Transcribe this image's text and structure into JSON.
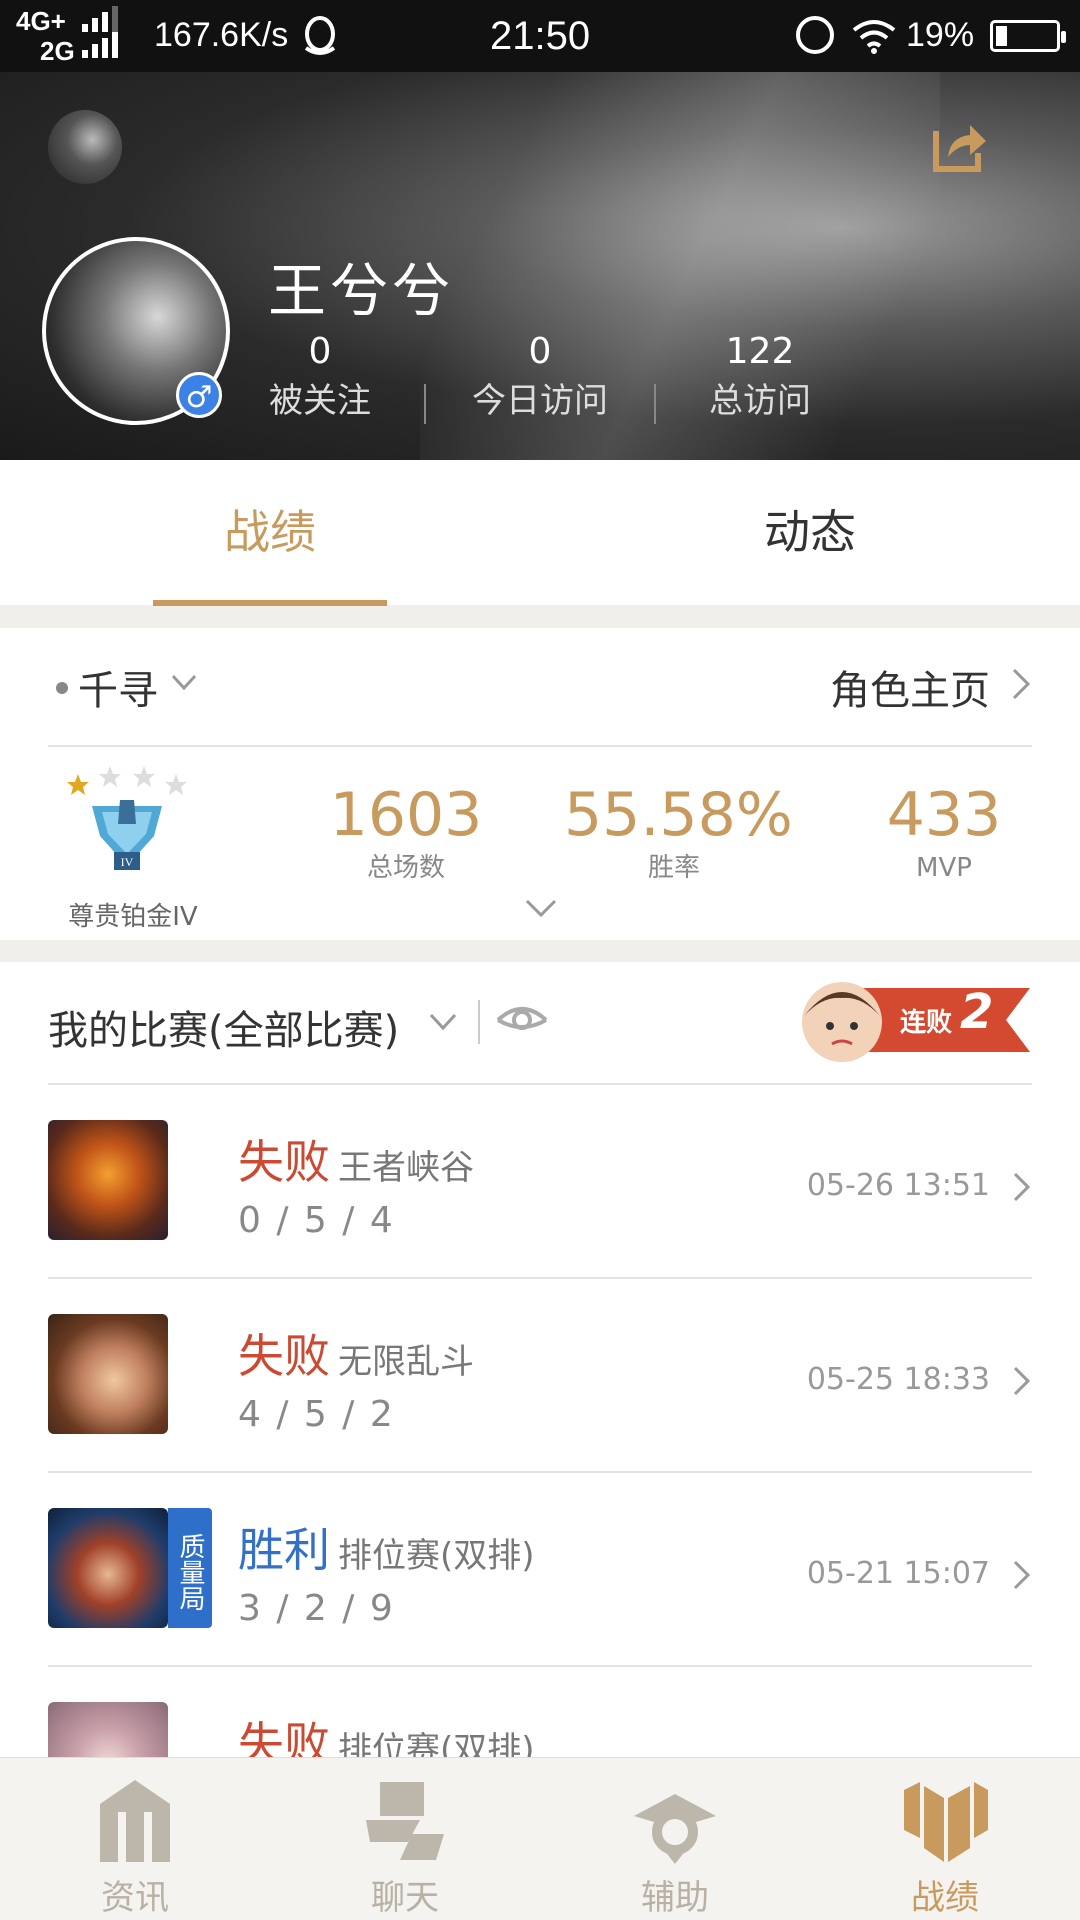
{
  "status_bar": {
    "network_top": "4G+",
    "network_bottom": "2G",
    "speed": "167.6K/s",
    "time": "21:50",
    "battery": "19%",
    "battery_level": 0.19
  },
  "profile": {
    "username": "王兮兮",
    "gender_symbol": "♂",
    "stats": [
      {
        "value": "0",
        "label": "被关注"
      },
      {
        "value": "0",
        "label": "今日访问"
      },
      {
        "value": "122",
        "label": "总访问"
      }
    ]
  },
  "tabs": [
    {
      "label": "战绩",
      "active": true
    },
    {
      "label": "动态",
      "active": false
    }
  ],
  "character": {
    "name": "千寻",
    "role_link": "角色主页",
    "rank_name": "尊贵铂金IV",
    "rank_stars": 4,
    "stats": [
      {
        "value": "1603",
        "label": "总场数"
      },
      {
        "value": "55.58%",
        "label": "胜率"
      },
      {
        "value": "433",
        "label": "MVP"
      }
    ]
  },
  "matches": {
    "title": "我的比赛(全部比赛)",
    "streak_label": "连败",
    "streak_count": "2",
    "items": [
      {
        "result": "失败",
        "outcome": "lose",
        "mode": "王者峡谷",
        "kda": "0 / 5 / 4",
        "date": "05-26 13:51",
        "quality_tag": ""
      },
      {
        "result": "失败",
        "outcome": "lose",
        "mode": "无限乱斗",
        "kda": "4 / 5 / 2",
        "date": "05-25 18:33",
        "quality_tag": ""
      },
      {
        "result": "胜利",
        "outcome": "win",
        "mode": "排位赛(双排)",
        "kda": "3 / 2 / 9",
        "date": "05-21 15:07",
        "quality_tag": "质量局"
      },
      {
        "result": "失败",
        "outcome": "lose",
        "mode": "排位赛(双排)",
        "kda": "",
        "date": "",
        "quality_tag": ""
      }
    ]
  },
  "bottom_nav": [
    {
      "label": "资讯",
      "icon": "news-icon",
      "active": false
    },
    {
      "label": "聊天",
      "icon": "chat-icon",
      "active": false
    },
    {
      "label": "辅助",
      "icon": "assist-icon",
      "active": false
    },
    {
      "label": "战绩",
      "icon": "record-icon",
      "active": true
    }
  ],
  "colors": {
    "accent": "#c89a5d",
    "lose": "#cc4a32",
    "win": "#3470c7",
    "quality_tag": "#2d6fc9"
  }
}
